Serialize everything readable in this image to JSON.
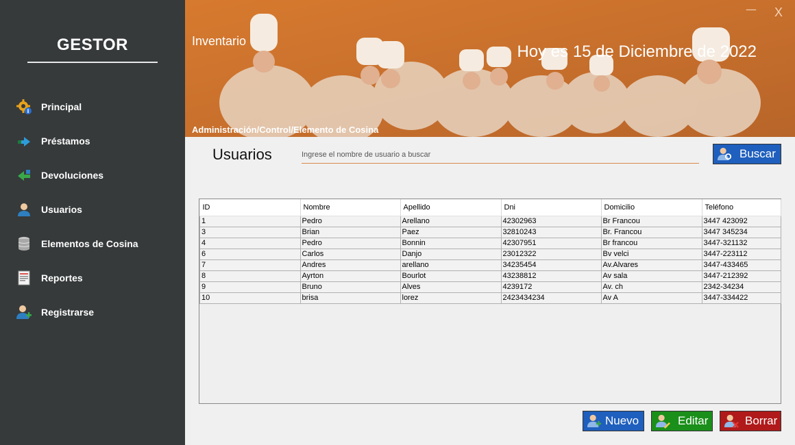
{
  "sidebar": {
    "brand": "GESTOR",
    "items": [
      {
        "label": "Principal",
        "icon": "gear-icon"
      },
      {
        "label": "Préstamos",
        "icon": "arrow-right-icon"
      },
      {
        "label": "Devoluciones",
        "icon": "arrow-left-icon"
      },
      {
        "label": "Usuarios",
        "icon": "user-icon"
      },
      {
        "label": "Elementos de Cosina",
        "icon": "database-icon"
      },
      {
        "label": "Reportes",
        "icon": "report-icon"
      },
      {
        "label": "Registrarse",
        "icon": "add-user-icon"
      }
    ]
  },
  "banner": {
    "title": "Inventario",
    "date": "Hoy es 15 de Diciembre de 2022",
    "breadcrumb": "Administración/Control/Elemento de Cosina",
    "minimize": "—",
    "close": "X"
  },
  "main": {
    "title": "Usuarios",
    "search": {
      "placeholder": "Ingrese el nombre de usuario a buscar",
      "value": ""
    },
    "buscar_label": "Buscar"
  },
  "table": {
    "headers": [
      "ID",
      "Nombre",
      "Apellido",
      "Dni",
      "Domicilio",
      "Teléfono"
    ],
    "rows": [
      [
        "1",
        "Pedro",
        "Arellano",
        "42302963",
        "Br Francou",
        "3447 423092"
      ],
      [
        "3",
        "Brian",
        "Paez",
        "32810243",
        "Br. Francou",
        "3447 345234"
      ],
      [
        "4",
        "Pedro",
        "Bonnin",
        "42307951",
        "Br francou",
        "3447-321132"
      ],
      [
        "6",
        "Carlos",
        "Danjo",
        "23012322",
        "Bv velci",
        "3447-223112"
      ],
      [
        "7",
        "Andres",
        "arellano",
        "34235454",
        "Av.Alvares",
        "3447-433465"
      ],
      [
        "8",
        "Ayrton",
        "Bourlot",
        "43238812",
        "Av sala",
        "3447-212392"
      ],
      [
        "9",
        "Bruno",
        "Alves",
        "4239172",
        "Av. ch",
        "2342-34234"
      ],
      [
        "10",
        "brisa",
        "lorez",
        "2423434234",
        "Av A",
        "3447-334422"
      ]
    ]
  },
  "actions": {
    "nuevo": "Nuevo",
    "editar": "Editar",
    "borrar": "Borrar"
  },
  "colors": {
    "sidebar": "#363a3b",
    "banner": "#c9712e",
    "buscar": "#1f5fbd",
    "nuevo": "#1f5fbd",
    "editar": "#1a8f1a",
    "borrar": "#b01a1a"
  }
}
